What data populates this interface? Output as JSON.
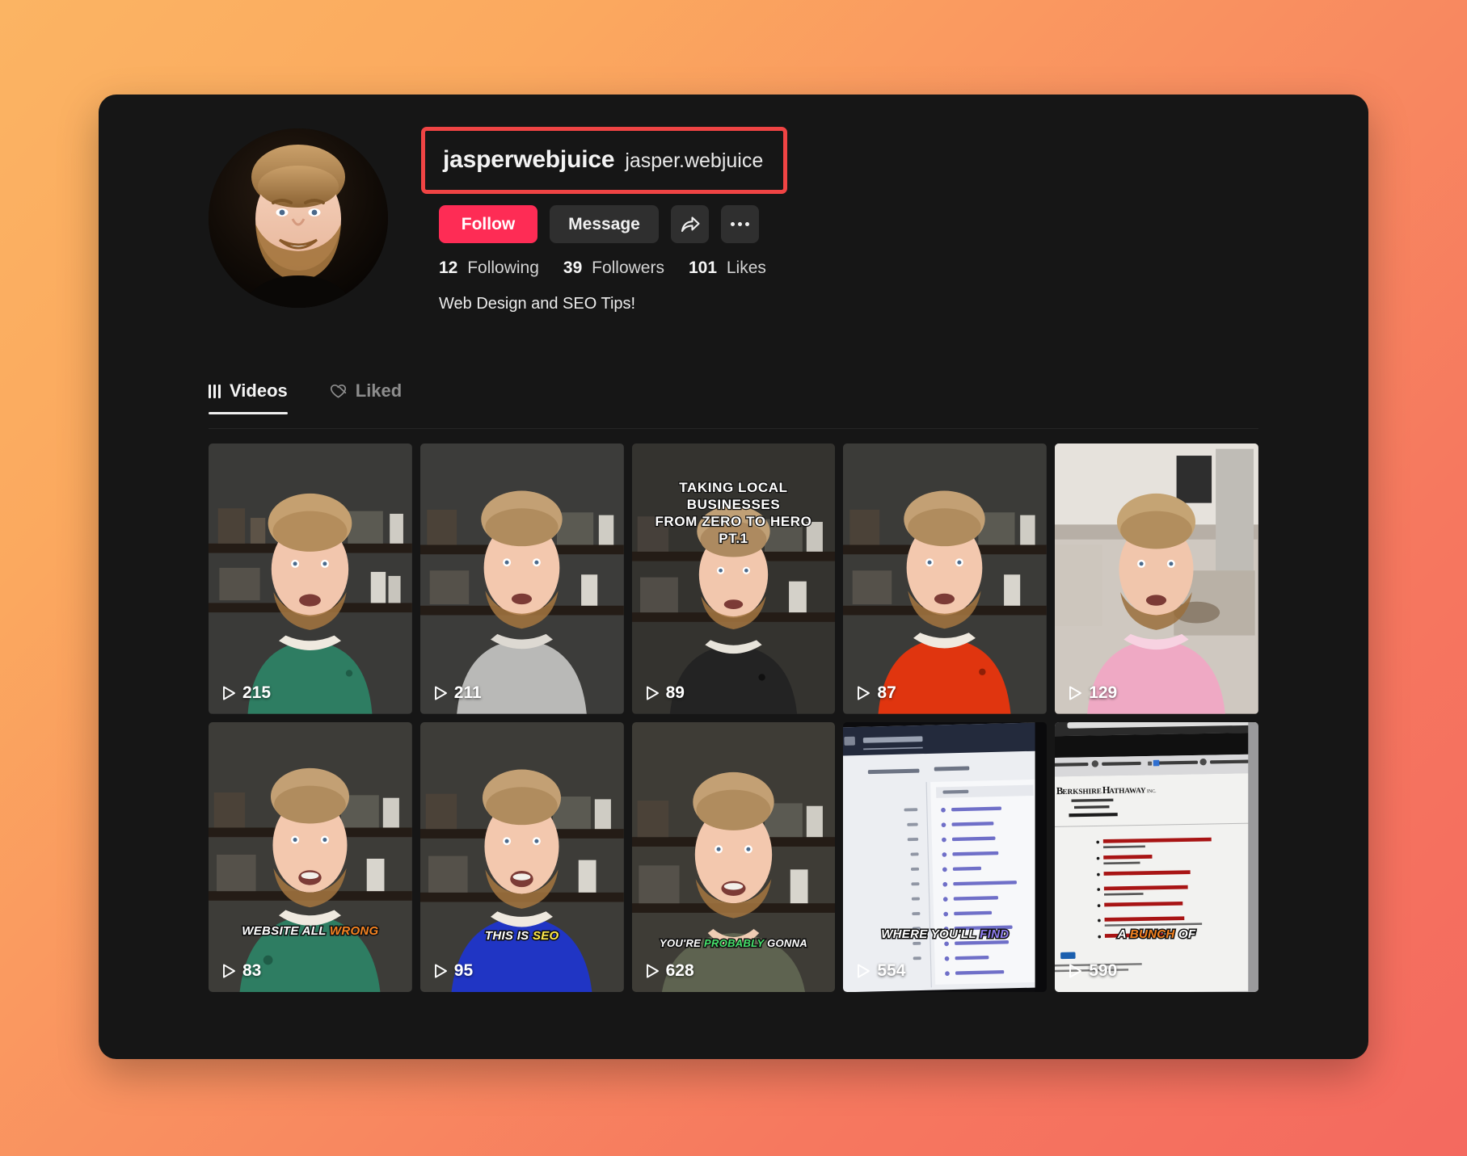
{
  "theme": {
    "accent_pink": "#FE2C55",
    "highlight_box": "#F04444",
    "app_background": "#161616",
    "backdrop_from": "#FBB463",
    "backdrop_to": "#F4695F"
  },
  "profile": {
    "display_name": "jasperwebjuice",
    "handle": "jasper.webjuice",
    "bio": "Web Design and SEO Tips!",
    "actions": {
      "follow_label": "Follow",
      "message_label": "Message",
      "share_icon": "share-arrow-icon",
      "more_icon": "more-dots-icon"
    },
    "stats": [
      {
        "value": "12",
        "label": "Following"
      },
      {
        "value": "39",
        "label": "Followers"
      },
      {
        "value": "101",
        "label": "Likes"
      }
    ]
  },
  "tabs": [
    {
      "label": "Videos",
      "icon": "grid-bars-icon",
      "active": true
    },
    {
      "label": "Liked",
      "icon": "heart-locked-icon",
      "active": false
    }
  ],
  "videos": [
    {
      "views": "215",
      "scene": "talking-head-green-hoodie",
      "caption": null
    },
    {
      "views": "211",
      "scene": "talking-head-grey-hoodie",
      "caption": null
    },
    {
      "views": "89",
      "scene": "talking-head-black-hoodie",
      "caption": {
        "position": "top",
        "lines": [
          [
            {
              "text": "TAKING LOCAL BUSINESSES",
              "color": "white"
            }
          ],
          [
            {
              "text": "FROM ZERO TO HERO",
              "color": "white"
            }
          ],
          [
            {
              "text": "PT.1",
              "color": "white"
            }
          ]
        ]
      }
    },
    {
      "views": "87",
      "scene": "talking-head-red-hoodie",
      "caption": null
    },
    {
      "views": "129",
      "scene": "talking-head-pink-hoodie-kitchen",
      "caption": null
    },
    {
      "views": "83",
      "scene": "talking-head-green-hoodie-wide",
      "caption": {
        "position": "low",
        "lines": [
          [
            {
              "text": "WEBSITE ALL",
              "color": "white"
            },
            {
              "text": "WRONG",
              "color": "orange"
            }
          ]
        ]
      }
    },
    {
      "views": "95",
      "scene": "talking-head-blue-hoodie",
      "caption": {
        "position": "low",
        "lines": [
          [
            {
              "text": "THIS IS",
              "color": "white"
            },
            {
              "text": "SEO",
              "color": "yellow"
            }
          ]
        ]
      }
    },
    {
      "views": "628",
      "scene": "talking-head-olive-shirt",
      "caption": {
        "position": "low",
        "lines": [
          [
            {
              "text": "YOU'RE",
              "color": "white"
            },
            {
              "text": "PROBABLY",
              "color": "green"
            },
            {
              "text": "GONNA",
              "color": "white"
            }
          ]
        ]
      }
    },
    {
      "views": "554",
      "scene": "screen-keyword-research-tool",
      "caption": {
        "position": "low",
        "lines": [
          [
            {
              "text": "WHERE YOU'LL",
              "color": "white"
            },
            {
              "text": "FIND",
              "color": "purple"
            }
          ]
        ]
      }
    },
    {
      "views": "590",
      "scene": "screen-berkshire-hathaway-site",
      "caption": {
        "position": "low",
        "lines": [
          [
            {
              "text": "A",
              "color": "white"
            },
            {
              "text": "BUNCH",
              "color": "orange"
            },
            {
              "text": "OF",
              "color": "white"
            }
          ]
        ]
      }
    }
  ]
}
